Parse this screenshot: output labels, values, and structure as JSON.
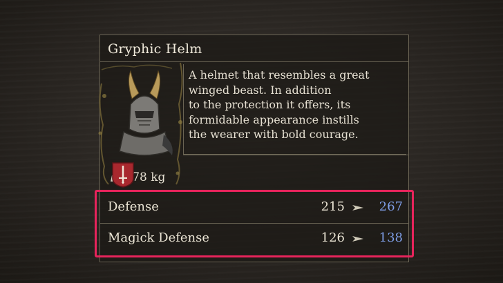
{
  "item": {
    "name": "Gryphic Helm",
    "weight": "2.78 kg",
    "description": "A helmet that resembles a great\nwinged beast. In addition\nto the protection it offers, its\nformidable appearance instills\nthe wearer with bold courage.",
    "icon": "helm-portrait",
    "crest_icon": "sword-crest-icon"
  },
  "stats": [
    {
      "label": "Defense",
      "current": "215",
      "new": "267"
    },
    {
      "label": "Magick Defense",
      "current": "126",
      "new": "138"
    }
  ],
  "colors": {
    "improved_value": "#7f9fe8",
    "highlight": "#e8245c",
    "border": "#6a6454",
    "crest_red": "#a8282e"
  }
}
